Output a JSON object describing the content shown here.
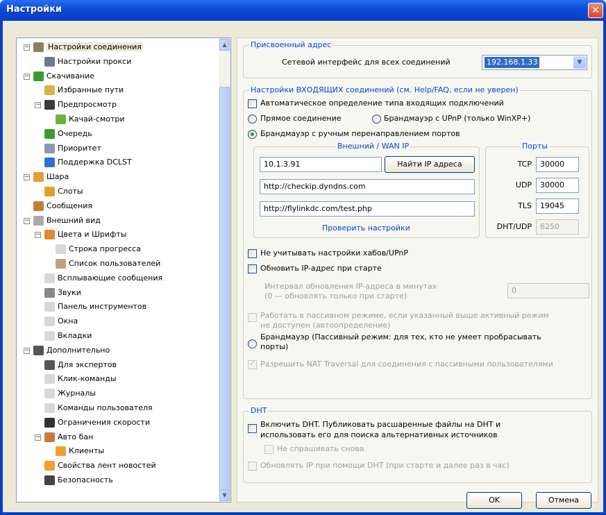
{
  "window": {
    "title": "Настройки",
    "close_label": "✕"
  },
  "tree": {
    "items": [
      {
        "label": "Настройки соединения",
        "level": 0,
        "expander": "⊟",
        "icon_color": "#8a7f62",
        "icon": "connection-icon",
        "selected": true
      },
      {
        "label": "Настройки прокси",
        "level": 1,
        "icon_color": "#6c7a8f",
        "icon": "proxy-icon"
      },
      {
        "label": "Скачивание",
        "level": 0,
        "expander": "⊟",
        "icon_color": "#3c9b2e",
        "icon": "download-icon"
      },
      {
        "label": "Избранные пути",
        "level": 1,
        "icon_color": "#d8b24a",
        "icon": "folder-icon"
      },
      {
        "label": "Предпросмотр",
        "level": 1,
        "expander": "⊟",
        "icon_color": "#3b3b3b",
        "icon": "film-icon"
      },
      {
        "label": "Качай-смотри",
        "level": 2,
        "icon_color": "#6cb33f",
        "icon": "leaf-icon"
      },
      {
        "label": "Очередь",
        "level": 1,
        "icon_color": "#3c9b2e",
        "icon": "queue-icon"
      },
      {
        "label": "Приоритет",
        "level": 1,
        "icon_color": "#8a9ab0",
        "icon": "priority-icon"
      },
      {
        "label": "Поддержка DCLST",
        "level": 1,
        "icon_color": "#2f6fd6",
        "icon": "dclst-icon"
      },
      {
        "label": "Шара",
        "level": 0,
        "expander": "⊟",
        "icon_color": "#e0a030",
        "icon": "share-icon"
      },
      {
        "label": "Слоты",
        "level": 1,
        "icon_color": "#e0a030",
        "icon": "slots-icon"
      },
      {
        "label": "Сообщения",
        "level": 0,
        "icon_color": "#c87a3a",
        "icon": "messages-icon"
      },
      {
        "label": "Внешний вид",
        "level": 0,
        "expander": "⊟",
        "icon_color": "#aaa",
        "icon": "appearance-icon"
      },
      {
        "label": "Цвета и Шрифты",
        "level": 1,
        "expander": "⊟",
        "icon_color": "#e08a30",
        "icon": "palette-icon"
      },
      {
        "label": "Строка прогресса",
        "level": 2,
        "icon_color": "#d8d8d8",
        "icon": "progress-icon"
      },
      {
        "label": "Список пользователей",
        "level": 2,
        "icon_color": "#c0a080",
        "icon": "userlist-icon"
      },
      {
        "label": "Всплывающие сообщения",
        "level": 1,
        "icon_color": "#d8d8d8",
        "icon": "popup-icon"
      },
      {
        "label": "Звуки",
        "level": 1,
        "icon_color": "#888",
        "icon": "sound-icon"
      },
      {
        "label": "Панель инструментов",
        "level": 1,
        "icon_color": "#d8d8d8",
        "icon": "toolbar-icon"
      },
      {
        "label": "Окна",
        "level": 1,
        "icon_color": "#d8d8d8",
        "icon": "windows-icon"
      },
      {
        "label": "Вкладки",
        "level": 1,
        "icon_color": "#d8d8d8",
        "icon": "tabs-icon"
      },
      {
        "label": "Дополнительно",
        "level": 0,
        "expander": "⊟",
        "icon_color": "#555",
        "icon": "tools-icon"
      },
      {
        "label": "Для экспертов",
        "level": 1,
        "icon_color": "#555",
        "icon": "expert-icon"
      },
      {
        "label": "Клик-команды",
        "level": 1,
        "icon_color": "#d8d8d8",
        "icon": "click-icon"
      },
      {
        "label": "Журналы",
        "level": 1,
        "icon_color": "#d8d8d8",
        "icon": "logs-icon"
      },
      {
        "label": "Команды пользователя",
        "level": 1,
        "icon_color": "#d8d8d8",
        "icon": "usercmd-icon"
      },
      {
        "label": "Ограничения скорости",
        "level": 1,
        "icon_color": "#333",
        "icon": "speed-icon"
      },
      {
        "label": "Авто бан",
        "level": 1,
        "expander": "⊟",
        "icon_color": "#c87a3a",
        "icon": "autoban-icon"
      },
      {
        "label": "Клиенты",
        "level": 2,
        "icon_color": "#f0a030",
        "icon": "clients-icon"
      },
      {
        "label": "Свойства лент новостей",
        "level": 1,
        "icon_color": "#f0a030",
        "icon": "rss-icon"
      },
      {
        "label": "Безопасность",
        "level": 1,
        "icon_color": "#444",
        "icon": "security-icon"
      }
    ]
  },
  "assigned": {
    "title": "Присвоенный адрес",
    "iface_label": "Сетевой интерфейс для всех соединений",
    "iface_value": "192.168.1.33"
  },
  "incoming": {
    "title": "Настройки ВХОДЯЩИХ соединений (см. Help/FAQ, если не уверен)",
    "auto_detect": "Автоматическое определение типа входящих подключений",
    "direct": "Прямое соединение",
    "upnp": "Брандмауэр с UPnP (только WinXP+)",
    "manual": "Брандмауэр с ручным перенаправлением портов",
    "wan_title": "Внешний / WAN IP",
    "wan_ip": "10.1.3.91",
    "find_ip_button": "Найти IP адреса",
    "url1": "http://checkip.dyndns.com",
    "url2": "http://flylinkdc.com/test.php",
    "check_link": "Проверить настройки",
    "ports_title": "Порты",
    "ports": [
      {
        "label": "TCP",
        "value": "30000"
      },
      {
        "label": "UDP",
        "value": "30000"
      },
      {
        "label": "TLS",
        "value": "19045"
      },
      {
        "label": "DHT/UDP",
        "value": "6250"
      }
    ],
    "ignore_hub": "Не учитывать настройки хабов/UPnP",
    "update_ip": "Обновить IP-адрес при старте",
    "interval_label_1": "Интервал обновления IP-адреса в минутах",
    "interval_label_2": "(0 — обновлять только при старте)",
    "interval_value": "0",
    "passive_1": "Работать в пассивном режиме, если указанный выше активный режим",
    "passive_2": "не доступен (автоопределение)",
    "firewall_passive_1": "Брандмауэр (Пассивный режим: для тех, кто не умеет пробрасывать",
    "firewall_passive_2": "порты)",
    "nat": "Разрешить NAT Traversal для соединения с пассивными пользователями"
  },
  "dht": {
    "title": "DHT",
    "enable_1": "Включить DHT. Публиковать расшаренные файлы на DHT и",
    "enable_2": "использовать его для поиска альтернативных источников",
    "dont_ask": "Не спрашивать снова",
    "update_ip": "Обновлять IP при помощи DHT (при старте и далее раз в час)"
  },
  "buttons": {
    "ok": "OK",
    "cancel": "Отмена"
  }
}
